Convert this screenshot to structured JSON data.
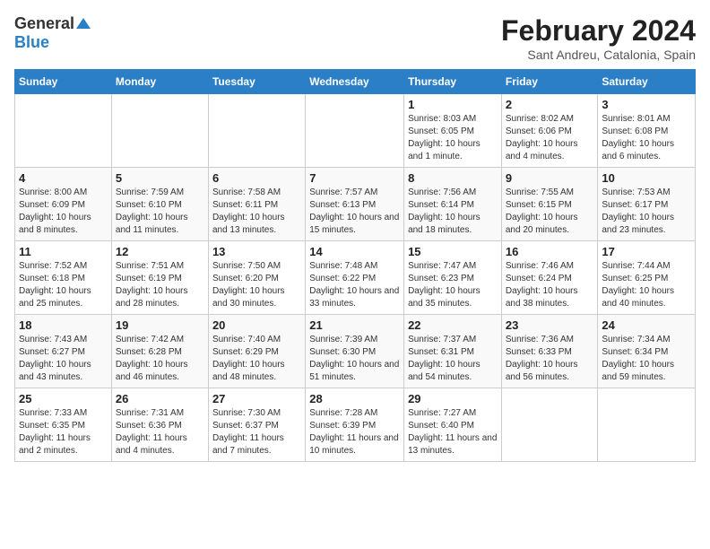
{
  "logo": {
    "general": "General",
    "blue": "Blue"
  },
  "title": "February 2024",
  "subtitle": "Sant Andreu, Catalonia, Spain",
  "headers": [
    "Sunday",
    "Monday",
    "Tuesday",
    "Wednesday",
    "Thursday",
    "Friday",
    "Saturday"
  ],
  "weeks": [
    [
      {
        "day": "",
        "info": ""
      },
      {
        "day": "",
        "info": ""
      },
      {
        "day": "",
        "info": ""
      },
      {
        "day": "",
        "info": ""
      },
      {
        "day": "1",
        "info": "Sunrise: 8:03 AM\nSunset: 6:05 PM\nDaylight: 10 hours and 1 minute."
      },
      {
        "day": "2",
        "info": "Sunrise: 8:02 AM\nSunset: 6:06 PM\nDaylight: 10 hours and 4 minutes."
      },
      {
        "day": "3",
        "info": "Sunrise: 8:01 AM\nSunset: 6:08 PM\nDaylight: 10 hours and 6 minutes."
      }
    ],
    [
      {
        "day": "4",
        "info": "Sunrise: 8:00 AM\nSunset: 6:09 PM\nDaylight: 10 hours and 8 minutes."
      },
      {
        "day": "5",
        "info": "Sunrise: 7:59 AM\nSunset: 6:10 PM\nDaylight: 10 hours and 11 minutes."
      },
      {
        "day": "6",
        "info": "Sunrise: 7:58 AM\nSunset: 6:11 PM\nDaylight: 10 hours and 13 minutes."
      },
      {
        "day": "7",
        "info": "Sunrise: 7:57 AM\nSunset: 6:13 PM\nDaylight: 10 hours and 15 minutes."
      },
      {
        "day": "8",
        "info": "Sunrise: 7:56 AM\nSunset: 6:14 PM\nDaylight: 10 hours and 18 minutes."
      },
      {
        "day": "9",
        "info": "Sunrise: 7:55 AM\nSunset: 6:15 PM\nDaylight: 10 hours and 20 minutes."
      },
      {
        "day": "10",
        "info": "Sunrise: 7:53 AM\nSunset: 6:17 PM\nDaylight: 10 hours and 23 minutes."
      }
    ],
    [
      {
        "day": "11",
        "info": "Sunrise: 7:52 AM\nSunset: 6:18 PM\nDaylight: 10 hours and 25 minutes."
      },
      {
        "day": "12",
        "info": "Sunrise: 7:51 AM\nSunset: 6:19 PM\nDaylight: 10 hours and 28 minutes."
      },
      {
        "day": "13",
        "info": "Sunrise: 7:50 AM\nSunset: 6:20 PM\nDaylight: 10 hours and 30 minutes."
      },
      {
        "day": "14",
        "info": "Sunrise: 7:48 AM\nSunset: 6:22 PM\nDaylight: 10 hours and 33 minutes."
      },
      {
        "day": "15",
        "info": "Sunrise: 7:47 AM\nSunset: 6:23 PM\nDaylight: 10 hours and 35 minutes."
      },
      {
        "day": "16",
        "info": "Sunrise: 7:46 AM\nSunset: 6:24 PM\nDaylight: 10 hours and 38 minutes."
      },
      {
        "day": "17",
        "info": "Sunrise: 7:44 AM\nSunset: 6:25 PM\nDaylight: 10 hours and 40 minutes."
      }
    ],
    [
      {
        "day": "18",
        "info": "Sunrise: 7:43 AM\nSunset: 6:27 PM\nDaylight: 10 hours and 43 minutes."
      },
      {
        "day": "19",
        "info": "Sunrise: 7:42 AM\nSunset: 6:28 PM\nDaylight: 10 hours and 46 minutes."
      },
      {
        "day": "20",
        "info": "Sunrise: 7:40 AM\nSunset: 6:29 PM\nDaylight: 10 hours and 48 minutes."
      },
      {
        "day": "21",
        "info": "Sunrise: 7:39 AM\nSunset: 6:30 PM\nDaylight: 10 hours and 51 minutes."
      },
      {
        "day": "22",
        "info": "Sunrise: 7:37 AM\nSunset: 6:31 PM\nDaylight: 10 hours and 54 minutes."
      },
      {
        "day": "23",
        "info": "Sunrise: 7:36 AM\nSunset: 6:33 PM\nDaylight: 10 hours and 56 minutes."
      },
      {
        "day": "24",
        "info": "Sunrise: 7:34 AM\nSunset: 6:34 PM\nDaylight: 10 hours and 59 minutes."
      }
    ],
    [
      {
        "day": "25",
        "info": "Sunrise: 7:33 AM\nSunset: 6:35 PM\nDaylight: 11 hours and 2 minutes."
      },
      {
        "day": "26",
        "info": "Sunrise: 7:31 AM\nSunset: 6:36 PM\nDaylight: 11 hours and 4 minutes."
      },
      {
        "day": "27",
        "info": "Sunrise: 7:30 AM\nSunset: 6:37 PM\nDaylight: 11 hours and 7 minutes."
      },
      {
        "day": "28",
        "info": "Sunrise: 7:28 AM\nSunset: 6:39 PM\nDaylight: 11 hours and 10 minutes."
      },
      {
        "day": "29",
        "info": "Sunrise: 7:27 AM\nSunset: 6:40 PM\nDaylight: 11 hours and 13 minutes."
      },
      {
        "day": "",
        "info": ""
      },
      {
        "day": "",
        "info": ""
      }
    ]
  ]
}
